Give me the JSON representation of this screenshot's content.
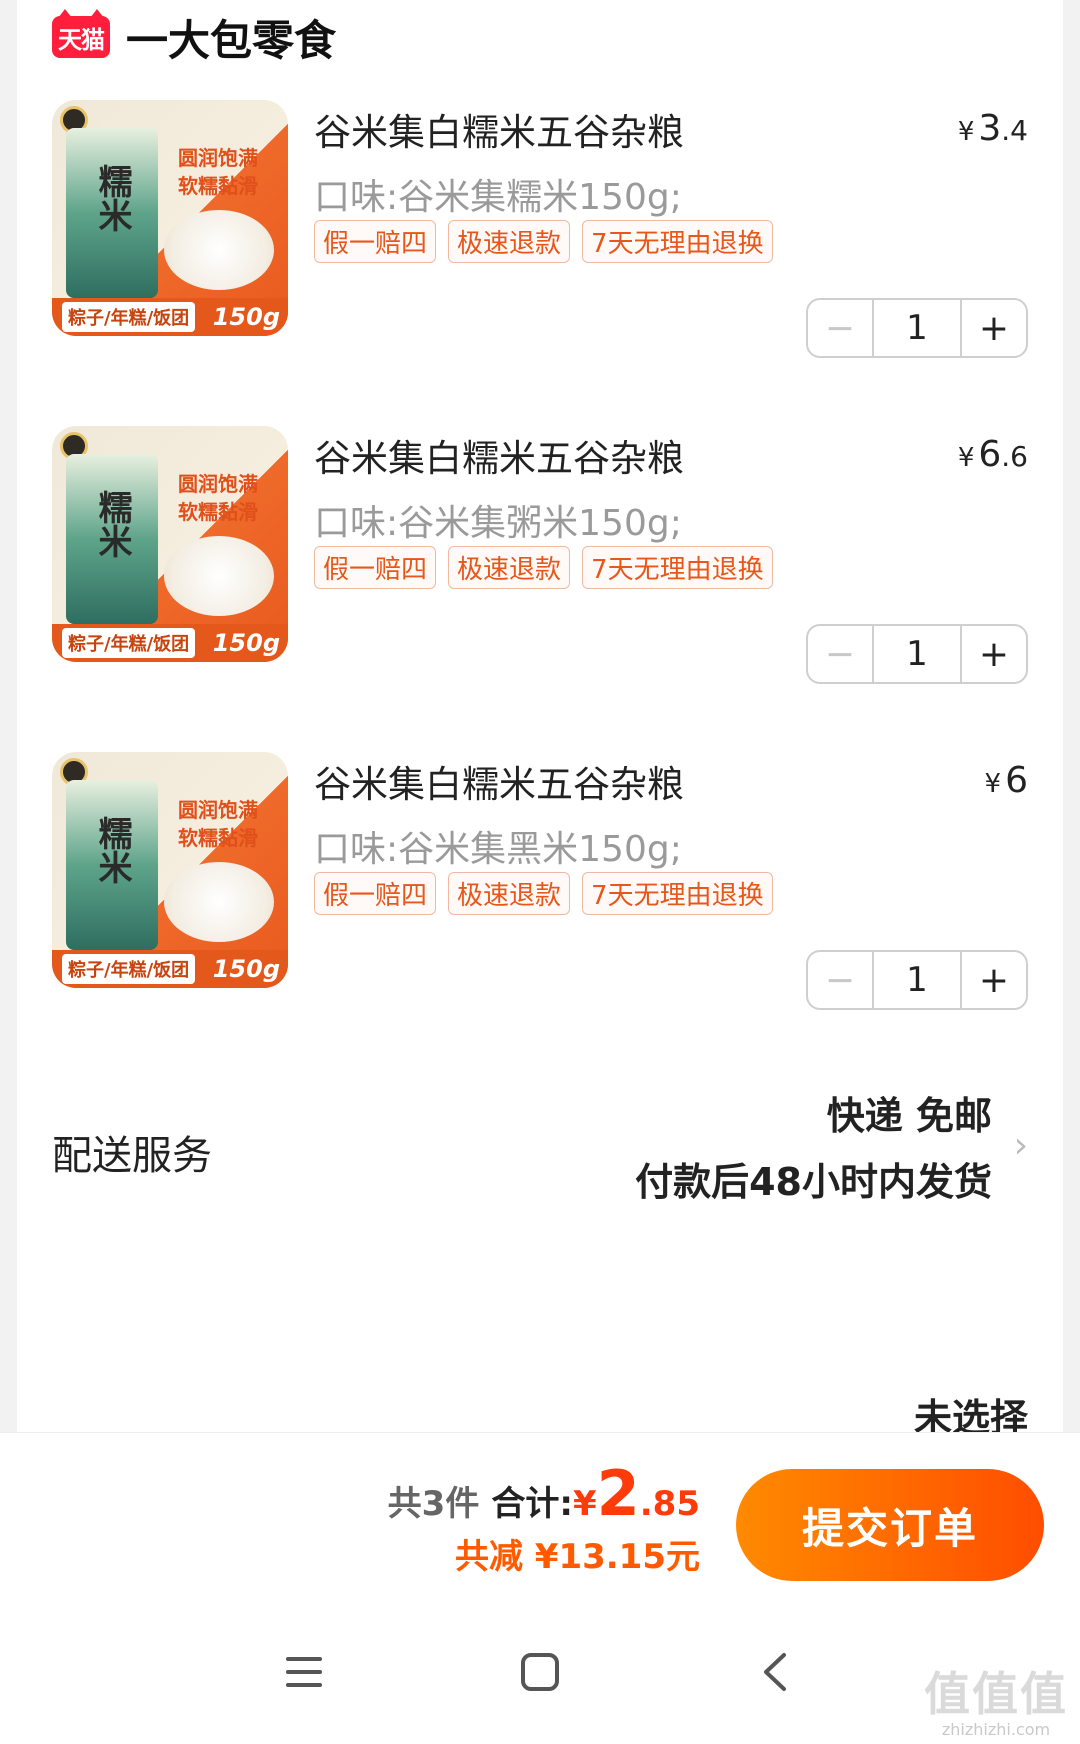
{
  "shop": {
    "badge": "天猫",
    "name": "一大包零食"
  },
  "product_image": {
    "bag_text": "糯米",
    "slogan_line1": "圆润饱满",
    "slogan_line2": "软糯黏滑",
    "strip_text": "粽子/年糕/饭团",
    "weight": "150g"
  },
  "items": [
    {
      "title": "谷米集白糯米五谷杂粮",
      "price_symbol": "¥",
      "price_int": "3",
      "price_dec": ".4",
      "spec": "口味:谷米集糯米150g;",
      "quantity": "1"
    },
    {
      "title": "谷米集白糯米五谷杂粮",
      "price_symbol": "¥",
      "price_int": "6",
      "price_dec": ".6",
      "spec": "口味:谷米集粥米150g;",
      "quantity": "1"
    },
    {
      "title": "谷米集白糯米五谷杂粮",
      "price_symbol": "¥",
      "price_int": "6",
      "price_dec": "",
      "spec": "口味:谷米集黑米150g;",
      "quantity": "1"
    }
  ],
  "tags": [
    "假一赔四",
    "极速退款",
    "7天无理由退换"
  ],
  "stepper": {
    "minus": "−",
    "plus": "+"
  },
  "delivery": {
    "label": "配送服务",
    "line1": "快递 免邮",
    "line2": "付款后48小时内发货",
    "chevron": "›"
  },
  "unselected": "未选择",
  "summary": {
    "count": "共3件",
    "total_label": "合计:",
    "total_yen": "¥",
    "total_int": "2",
    "total_dec": ".85",
    "discount": "共减 ¥13.15元"
  },
  "submit_label": "提交订单",
  "watermark": {
    "big": "值值值",
    "small": "zhizhizhi.com"
  },
  "colors": {
    "accent": "#ff4d00",
    "price_red": "#ff3b0a",
    "tag_orange": "#e8571a"
  }
}
